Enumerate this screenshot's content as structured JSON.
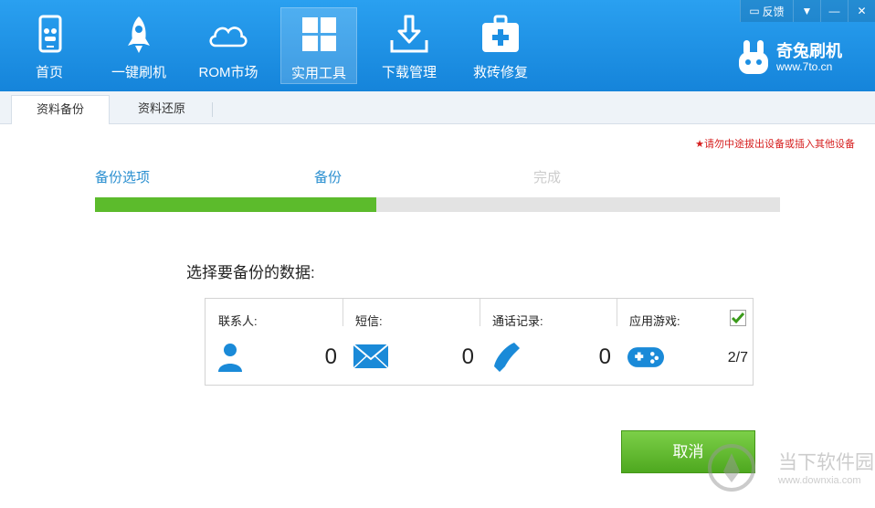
{
  "nav": {
    "items": [
      {
        "label": "首页",
        "icon": "phone-icon"
      },
      {
        "label": "一键刷机",
        "icon": "rocket-icon"
      },
      {
        "label": "ROM市场",
        "icon": "cloud-icon"
      },
      {
        "label": "实用工具",
        "icon": "tools-grid-icon",
        "active": true
      },
      {
        "label": "下载管理",
        "icon": "download-icon"
      },
      {
        "label": "救砖修复",
        "icon": "first-aid-kit-icon"
      }
    ]
  },
  "window": {
    "feedback_label": "反馈",
    "dropdown_glyph": "▼",
    "minimize_glyph": "—",
    "close_glyph": "✕"
  },
  "brand": {
    "name": "奇兔刷机",
    "url": "www.7to.cn"
  },
  "subtabs": [
    {
      "label": "资料备份",
      "active": true
    },
    {
      "label": "资料还原",
      "active": false
    }
  ],
  "warning": "★请勿中途拔出设备或插入其他设备",
  "steps": [
    {
      "label": "备份选项",
      "state": "done"
    },
    {
      "label": "备份",
      "state": "done"
    },
    {
      "label": "完成",
      "state": "pending"
    }
  ],
  "progress": {
    "percent": 41
  },
  "prompt": "选择要备份的数据:",
  "data_items": [
    {
      "label": "联系人:",
      "icon": "contact-icon",
      "count": "0"
    },
    {
      "label": "短信:",
      "icon": "envelope-icon",
      "count": "0"
    },
    {
      "label": "通话记录:",
      "icon": "phone-handset-icon",
      "count": "0"
    },
    {
      "label": "应用游戏:",
      "icon": "gamepad-icon",
      "count": "2/7",
      "checked": true
    }
  ],
  "cancel_label": "取消",
  "watermark": {
    "name": "当下软件园",
    "url": "www.downxia.com"
  },
  "colors": {
    "header_blue": "#1c8fe3",
    "progress_green": "#5cbb2c",
    "step_done": "#2a8fd0",
    "step_pending": "#cccccc",
    "warning_red": "#d61f1f",
    "button_green": "#5cb82a"
  }
}
